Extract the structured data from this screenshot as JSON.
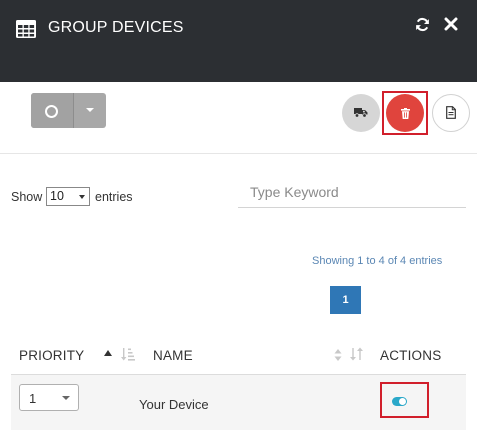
{
  "header": {
    "title": "GROUP DEVICES",
    "icon": "table-grid-icon",
    "actions": [
      "refresh-icon",
      "close-icon"
    ]
  },
  "toolbar": {
    "split_button_icon": "circle-icon",
    "split_button_caret": "chevron-down-icon",
    "buttons": [
      "truck-icon",
      "trash-icon",
      "file-icon"
    ],
    "trash_color": "#e0443d"
  },
  "controls": {
    "show_label": "Show",
    "entries_value": "10",
    "entries_label": "entries",
    "search_placeholder": "Type Keyword"
  },
  "pagination": {
    "info": "Showing 1 to 4 of 4 entries",
    "current_page": "1",
    "accent": "#2f77b6"
  },
  "table": {
    "columns": [
      "PRIORITY",
      "NAME",
      "ACTIONS"
    ],
    "rows": [
      {
        "priority": "1",
        "name": "Your Device",
        "enabled": true
      }
    ]
  },
  "colors": {
    "header_bg": "#2c2f33",
    "highlight": "#d11f2b",
    "toggle_on": "#2aa8c9"
  }
}
